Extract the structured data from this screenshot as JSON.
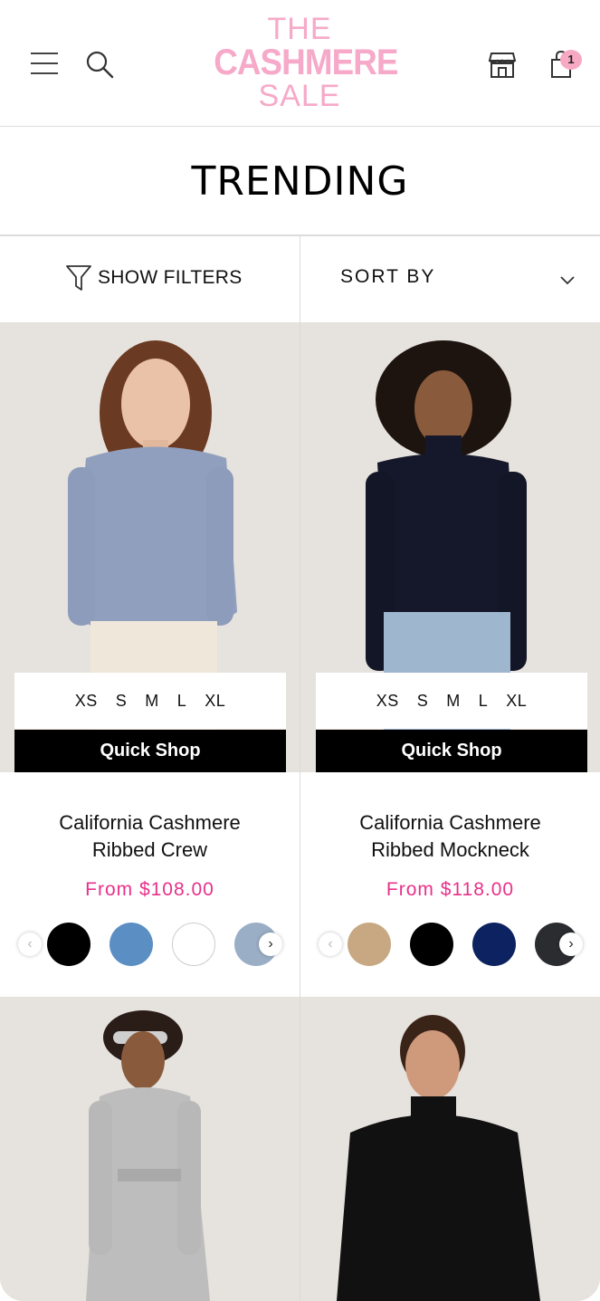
{
  "header": {
    "logo_line1": "THE",
    "logo_line2": "CASHMERE",
    "logo_line3": "SALE",
    "cart_count": "1",
    "brand_color": "#f6a9c8"
  },
  "page": {
    "title": "TRENDING"
  },
  "toolbar": {
    "show_filters_label": "SHOW FILTERS",
    "sort_by_label": "SORT BY"
  },
  "products": [
    {
      "name_line1": "California Cashmere",
      "name_line2": "Ribbed Crew",
      "price": "From $108.00",
      "sizes": [
        "XS",
        "S",
        "M",
        "L",
        "XL"
      ],
      "quick_shop": "Quick Shop",
      "swatches": [
        "#000000",
        "#5b8fc4",
        "#ffffff",
        "#9aaec6"
      ],
      "sweater_color": "#8f9fbd"
    },
    {
      "name_line1": "California Cashmere",
      "name_line2": "Ribbed Mockneck",
      "price": "From $118.00",
      "sizes": [
        "XS",
        "S",
        "M",
        "L",
        "XL"
      ],
      "quick_shop": "Quick Shop",
      "swatches": [
        "#c8a882",
        "#000000",
        "#0d2260",
        "#2a2c30"
      ],
      "sweater_color": "#15182a"
    },
    {
      "sweater_color": "#bdbdbd"
    },
    {
      "sweater_color": "#111111"
    }
  ],
  "colors": {
    "price_pink": "#e8318a",
    "card_bg": "#e8e4df"
  }
}
